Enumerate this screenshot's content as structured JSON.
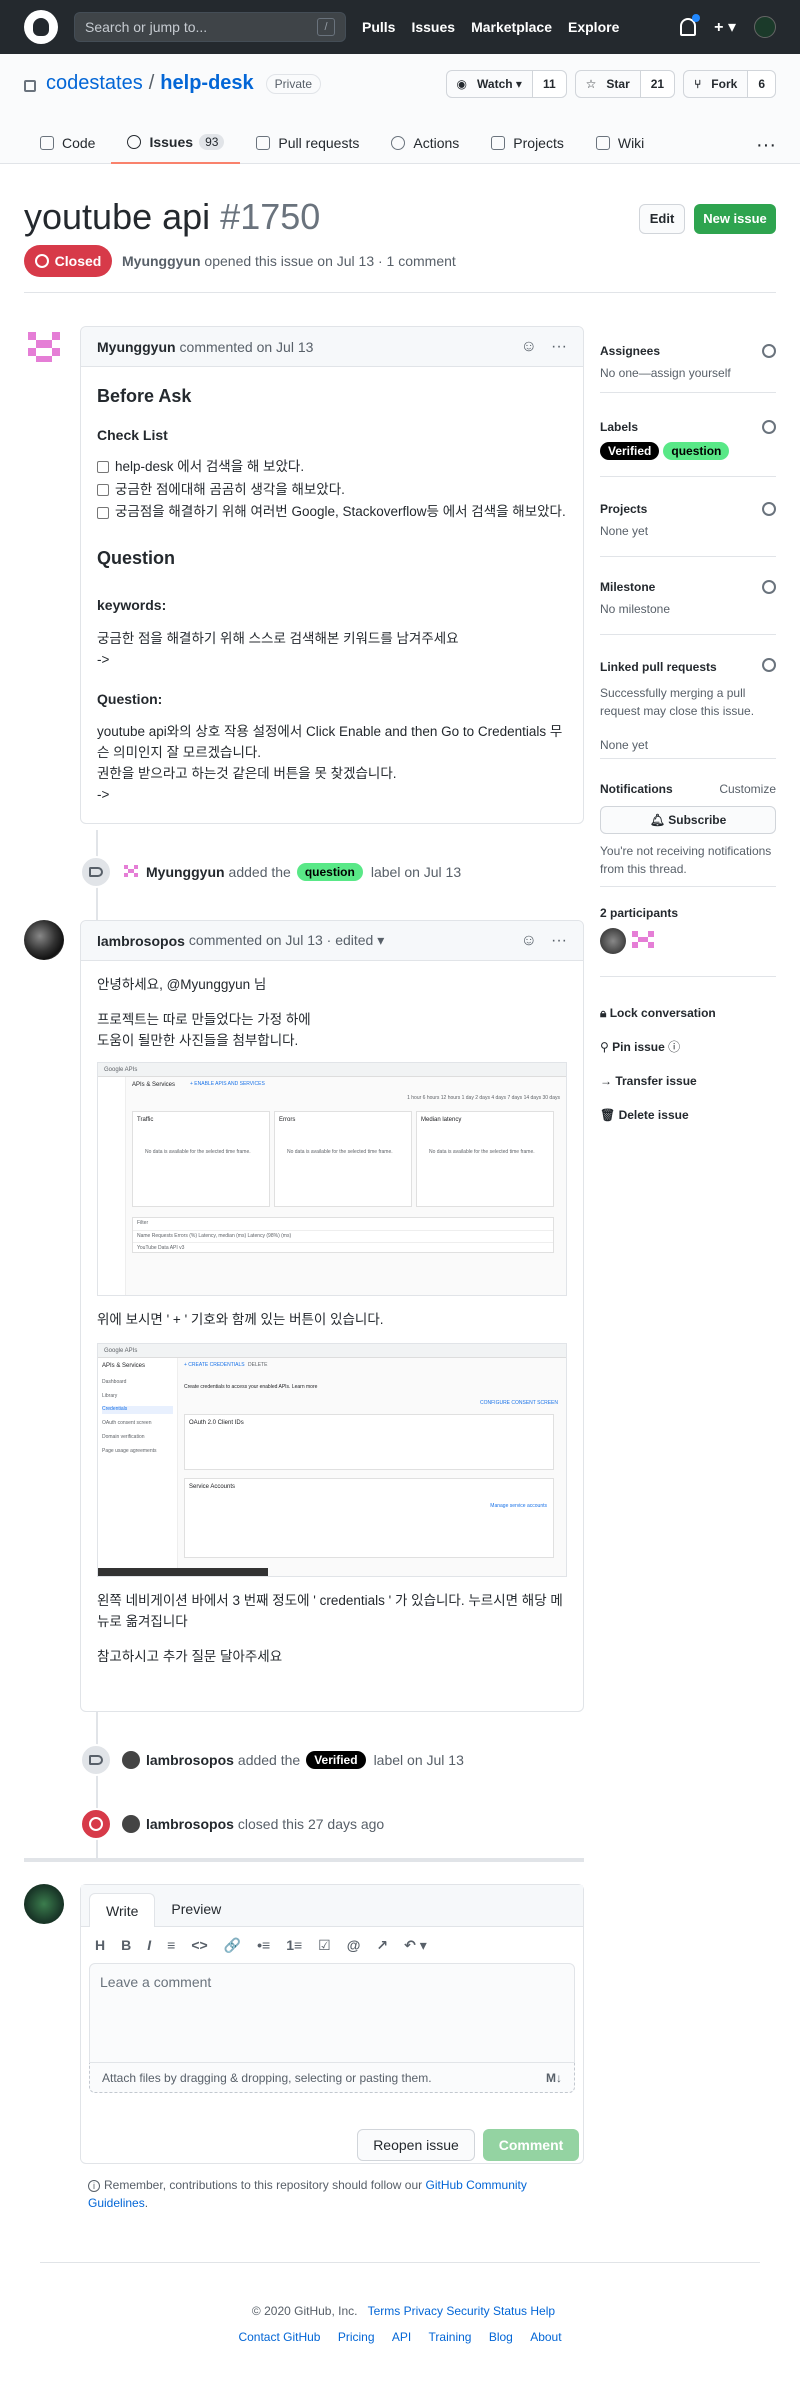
{
  "topbar": {
    "search_placeholder": "Search or jump to...",
    "slash": "/",
    "nav": [
      "Pulls",
      "Issues",
      "Marketplace",
      "Explore"
    ],
    "plus": "+ ▾"
  },
  "repo": {
    "owner": "codestates",
    "sep": "/",
    "name": "help-desk",
    "visibility": "Private",
    "watch_label": "Watch ▾",
    "watch_count": "11",
    "star_label": "Star",
    "star_count": "21",
    "fork_label": "Fork",
    "fork_count": "6"
  },
  "tabs": [
    {
      "label": "Code"
    },
    {
      "label": "Issues",
      "count": "93"
    },
    {
      "label": "Pull requests"
    },
    {
      "label": "Actions"
    },
    {
      "label": "Projects"
    },
    {
      "label": "Wiki"
    }
  ],
  "more": "···",
  "issue": {
    "title": "youtube api",
    "number": "#1750",
    "edit_label": "Edit",
    "new_label": "New issue",
    "state": "Closed",
    "author": "Myunggyun",
    "meta_rest": " opened this issue on Jul 13 · 1 comment"
  },
  "comment1": {
    "author": "Myunggyun",
    "when": "commented on Jul 13",
    "h_before": "Before Ask",
    "h_check": "Check List",
    "checks": [
      "help-desk 에서 검색을 해 보았다.",
      "궁금한 점에대해 곰곰히 생각을 해보았다.",
      "궁금점을 해결하기 위해 여러번 Google, Stackoverflow등 에서 검색을 해보았다."
    ],
    "h_question": "Question",
    "h_keywords": "keywords:",
    "keywords_text": "궁금한 점을 해결하기 위해 스스로 검색해본 키워드를 남겨주세요",
    "arrow1": "->",
    "h_q2": "Question:",
    "q_line1": "youtube api와의 상호 작용 설정에서 Click Enable and then Go to Credentials 무슨 의미인지 잘 모르겠습니다.",
    "q_line2": "권한을 받으라고 하는것 같은데 버튼을 못 찾겠습니다.",
    "arrow2": "->"
  },
  "event1": {
    "actor": "Myunggyun",
    "pre": "added the",
    "label": "question",
    "post": "label on Jul 13"
  },
  "comment2": {
    "author": "lambrosopos",
    "when": "commented on Jul 13 · edited ▾",
    "greet": "안녕하세요, @Myunggyun 님",
    "p1a": "프로젝트는 따로 만들었다는 가정 하에",
    "p1b": "도움이 될만한 사진들을 첨부합니다.",
    "p2": "위에 보시면 ' + ' 기호와 함께 있는 버튼이 있습니다.",
    "p3": "왼쪽 네비게이션 바에서 3 번째 정도에 ' credentials ' 가 있습니다. 누르시면 해당 메뉴로 옮겨집니다",
    "p4": "참고하시고 추가 질문 달아주세요",
    "shot1": {
      "brand": "Google APIs",
      "section": "APIs & Services",
      "link": "+ ENABLE APIS AND SERVICES",
      "ranges": "1 hour  6 hours  12 hours  1 day  2 days  4 days  7 days  14 days  30 days",
      "p1": "Traffic",
      "p2": "Errors",
      "p3": "Median latency",
      "nodata": "No data is available for the selected time frame.",
      "filter": "Filter",
      "cols": "Name   Requests   Errors (%)   Latency, median (ms)   Latency (98%) (ms)",
      "row": "YouTube Data API v3"
    },
    "shot2": {
      "brand": "Google APIs",
      "section": "APIs & Services",
      "create": "+ CREATE CREDENTIALS",
      "delete": "DELETE",
      "nav": [
        "Dashboard",
        "Library",
        "Credentials",
        "OAuth consent screen",
        "Domain verification",
        "Page usage agreements"
      ],
      "hint": "Create credentials to access your enabled APIs. Learn more",
      "configure": "CONFIGURE CONSENT SCREEN",
      "oauth": "OAuth 2.0 Client IDs",
      "service": "Service Accounts",
      "manage": "Manage service accounts"
    }
  },
  "event2": {
    "actor": "lambrosopos",
    "pre": "added the",
    "label": "Verified",
    "post": "label on Jul 13"
  },
  "event3": {
    "actor": "lambrosopos",
    "post": "closed this 27 days ago"
  },
  "editor": {
    "write": "Write",
    "preview": "Preview",
    "tools": [
      "H",
      "B",
      "I",
      "≡",
      "<>",
      "🔗",
      "•≡",
      "1≡",
      "☑",
      "@",
      "↗",
      "↶ ▾"
    ],
    "placeholder": "Leave a comment",
    "attach": "Attach files by dragging & dropping, selecting or pasting them.",
    "md": "M↓",
    "reopen": "Reopen issue",
    "submit": "Comment"
  },
  "remember": {
    "text": "Remember, contributions to this repository should follow our ",
    "link": "GitHub Community Guidelines",
    "end": "."
  },
  "sidebar": {
    "assignees_h": "Assignees",
    "assignees_v": "No one—assign yourself",
    "labels_h": "Labels",
    "labels": [
      "Verified",
      "question"
    ],
    "projects_h": "Projects",
    "projects_v": "None yet",
    "milestone_h": "Milestone",
    "milestone_v": "No milestone",
    "linked_h": "Linked pull requests",
    "linked_text": "Successfully merging a pull request may close this issue.",
    "linked_v": "None yet",
    "notif_h": "Notifications",
    "notif_customize": "Customize",
    "subscribe": "Subscribe",
    "notif_text": "You're not receiving notifications from this thread.",
    "participants_h": "2 participants",
    "lock": "Lock conversation",
    "pin": "Pin issue",
    "transfer": "Transfer issue",
    "delete": "Delete issue"
  },
  "footer": {
    "copy": "© 2020 GitHub, Inc.",
    "row1": [
      "Terms",
      "Privacy",
      "Security",
      "Status",
      "Help"
    ],
    "row2": [
      "Contact GitHub",
      "Pricing",
      "API",
      "Training",
      "Blog",
      "About"
    ]
  },
  "colors": {
    "accent": "#0366d6",
    "closed": "#d73a49",
    "green": "#2ea44f",
    "question": "#59e887",
    "verified": "#000000"
  }
}
